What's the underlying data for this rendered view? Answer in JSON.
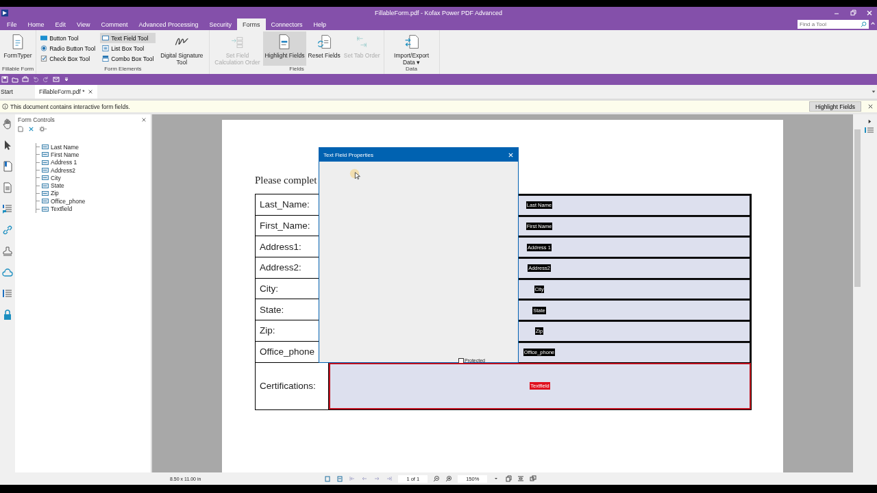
{
  "window": {
    "title": "FillableForm.pdf - Kofax Power PDF Advanced"
  },
  "search": {
    "placeholder": "Find a Tool"
  },
  "menu_tabs": [
    {
      "label": "File",
      "selected": false
    },
    {
      "label": "Home",
      "selected": false
    },
    {
      "label": "Edit",
      "selected": false
    },
    {
      "label": "View",
      "selected": false
    },
    {
      "label": "Comment",
      "selected": false
    },
    {
      "label": "Advanced Processing",
      "selected": false
    },
    {
      "label": "Security",
      "selected": false
    },
    {
      "label": "Forms",
      "selected": true
    },
    {
      "label": "Connectors",
      "selected": false
    },
    {
      "label": "Help",
      "selected": false
    }
  ],
  "ribbon": {
    "groups": [
      {
        "title": "Fillable Form",
        "items": [
          {
            "kind": "large",
            "label": "FormTyper",
            "selected": false,
            "disabled": false
          }
        ]
      },
      {
        "title": "Form Elements",
        "items": [
          {
            "kind": "small",
            "label": "Button Tool",
            "selected": false
          },
          {
            "kind": "small",
            "label": "Radio Button Tool",
            "selected": false
          },
          {
            "kind": "small",
            "label": "Check Box Tool",
            "selected": false
          },
          {
            "kind": "small",
            "label": "Text Field Tool",
            "selected": true
          },
          {
            "kind": "small",
            "label": "List Box Tool",
            "selected": false
          },
          {
            "kind": "small",
            "label": "Combo Box Tool",
            "selected": false
          },
          {
            "kind": "large",
            "label": "Digital Signature Tool",
            "selected": false,
            "disabled": false
          }
        ]
      },
      {
        "title": "Fields",
        "items": [
          {
            "kind": "large",
            "label": "Set Field Calculation Order",
            "selected": false,
            "disabled": true
          },
          {
            "kind": "large",
            "label": "Highlight Fields",
            "selected": true,
            "disabled": false
          },
          {
            "kind": "large",
            "label": "Reset Fields",
            "selected": false,
            "disabled": false
          },
          {
            "kind": "large",
            "label": "Set Tab Order",
            "selected": false,
            "disabled": true
          }
        ]
      },
      {
        "title": "Data",
        "items": [
          {
            "kind": "large",
            "label": "Import/Export Data",
            "dropdown": "▾",
            "selected": false,
            "disabled": false
          }
        ]
      }
    ]
  },
  "doc_tabs": [
    {
      "label": "Start",
      "selected": false
    },
    {
      "label": "FillableForm.pdf *",
      "selected": true,
      "closable": true
    }
  ],
  "info_bar": {
    "message": "This document contains interactive form fields.",
    "button": "Highlight Fields"
  },
  "form_controls": {
    "title": "Form Controls",
    "items": [
      {
        "label": "Last Name",
        "selected": false
      },
      {
        "label": "First Name",
        "selected": false
      },
      {
        "label": "Address 1",
        "selected": false
      },
      {
        "label": "Address2",
        "selected": false
      },
      {
        "label": "City",
        "selected": false
      },
      {
        "label": "State",
        "selected": false
      },
      {
        "label": "Zip",
        "selected": false
      },
      {
        "label": "Office_phone",
        "selected": false
      },
      {
        "label": "Textfield",
        "selected": false
      }
    ]
  },
  "document": {
    "heading": "Please complet",
    "rows": [
      {
        "label": "Last_Name:",
        "field": "Last Name",
        "selected": false
      },
      {
        "label": "First_Name:",
        "field": "First Name",
        "selected": false
      },
      {
        "label": "Address1:",
        "field": "Address 1",
        "selected": false
      },
      {
        "label": "Address2:",
        "field": "Address2",
        "selected": false
      },
      {
        "label": "City:",
        "field": "City",
        "selected": false
      },
      {
        "label": "State:",
        "field": "State",
        "selected": false
      },
      {
        "label": "Zip:",
        "field": "Zip",
        "selected": false
      },
      {
        "label": "Office_phone",
        "field": "Office_phone",
        "selected": false
      },
      {
        "label": "Certifications:",
        "field": "Textfield",
        "selected": true,
        "tall": true
      }
    ]
  },
  "dialog": {
    "title": "Text Field Properties",
    "checkbox": {
      "label": "Protected",
      "checked": false
    }
  },
  "status_bar": {
    "page_size": "8.50 x 11.00 in",
    "page": "1 of 1",
    "zoom": "150%"
  }
}
